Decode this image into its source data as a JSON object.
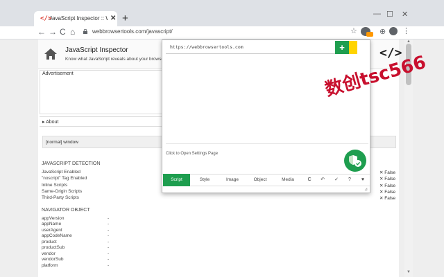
{
  "browser": {
    "tab": {
      "favicon": "</>",
      "title": "JavaScript Inspector :: WebBrowserTools",
      "close": "✕",
      "new_tab": "+"
    },
    "window_controls": {
      "minimize": "—",
      "maximize": "☐",
      "close": "✕"
    },
    "nav": {
      "back": "←",
      "forward": "→",
      "reload": "C",
      "home": "⌂"
    },
    "address": "webbrowsertools.com/javascript/",
    "star": "☆",
    "globe": "⊕",
    "menu": "⋮"
  },
  "page": {
    "site_title": "JavaScript Inspector",
    "site_desc": "Know what JavaScript reveals about your browser",
    "code_logo": "</>",
    "advertisement": "Advertisement",
    "about": "▸ About",
    "window_label": "[normal] window",
    "js_detection": {
      "title": "JAVASCRIPT DETECTION",
      "rows": [
        {
          "label": "JavaScript Enabled",
          "value": "✕ False"
        },
        {
          "label": "\"noscript\" Tag Enabled",
          "value": "✕ False"
        },
        {
          "label": "Inline Scripts",
          "value": "✕ False"
        },
        {
          "label": "Same-Origin Scripts",
          "value": "✕ False"
        },
        {
          "label": "Third-Party Scripts",
          "value": "✕ False"
        }
      ]
    },
    "navigator": {
      "title": "NAVIGATOR OBJECT",
      "rows": [
        {
          "label": "appVersion",
          "value": "-"
        },
        {
          "label": "appName",
          "value": "-"
        },
        {
          "label": "userAgent",
          "value": "-"
        },
        {
          "label": "appCodeName",
          "value": "-"
        },
        {
          "label": "product",
          "value": "-"
        },
        {
          "label": "productSub",
          "value": "-"
        },
        {
          "label": "vendor",
          "value": "-"
        },
        {
          "label": "vendorSub",
          "value": "-"
        },
        {
          "label": "platform",
          "value": "-"
        }
      ]
    }
  },
  "popup": {
    "url_value": "https://webbrowsertools.com",
    "add_label": "+",
    "settings_hint": "Click to Open Settings Page",
    "tabs": [
      "Script",
      "Style",
      "Image",
      "Object",
      "Media"
    ],
    "icons": {
      "refresh": "C",
      "undo": "↶",
      "check": "✓",
      "help": "?",
      "heart": "♥"
    },
    "grip": "⊿"
  },
  "watermark": "数创tsc566",
  "colors": {
    "accent": "#1e9e4f",
    "watermark": "#c8102e"
  }
}
